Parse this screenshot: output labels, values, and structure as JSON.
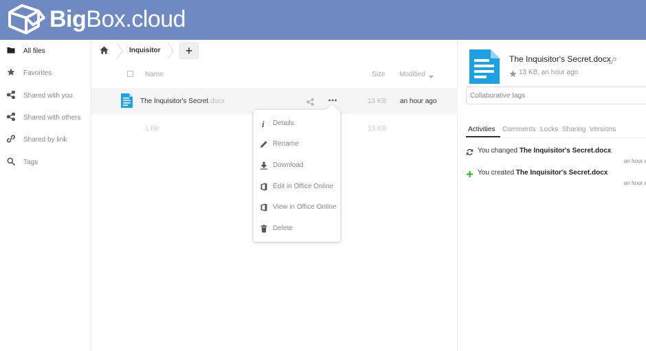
{
  "brand": {
    "name_bold": "Big",
    "name_rest": "Box.cloud"
  },
  "sidebar": {
    "items": [
      {
        "label": "All files",
        "icon": "folder-icon",
        "active": true
      },
      {
        "label": "Favorites",
        "icon": "star-icon"
      },
      {
        "label": "Shared with you",
        "icon": "share-icon"
      },
      {
        "label": "Shared with others",
        "icon": "share-icon"
      },
      {
        "label": "Shared by link",
        "icon": "link-icon"
      },
      {
        "label": "Tags",
        "icon": "search-icon"
      }
    ]
  },
  "breadcrumb": {
    "folder": "Inquisitor",
    "new_label": "+"
  },
  "table": {
    "headers": {
      "name": "Name",
      "size": "Size",
      "modified": "Modified"
    },
    "files": [
      {
        "name": "The Inquisitor's Secret",
        "ext": ".docx",
        "size": "13 KB",
        "modified": "an hour ago"
      }
    ],
    "summary": {
      "count": "1 file",
      "total_size": "13 KB"
    }
  },
  "context_menu": {
    "items": [
      {
        "label": "Details",
        "icon": "info-icon"
      },
      {
        "label": "Rename",
        "icon": "pencil-icon"
      },
      {
        "label": "Download",
        "icon": "download-icon"
      },
      {
        "label": "Edit in Office Online",
        "icon": "office-icon"
      },
      {
        "label": "View in Office Online",
        "icon": "office-icon"
      },
      {
        "label": "Delete",
        "icon": "trash-icon"
      }
    ]
  },
  "details": {
    "title": "The Inquisitor's Secret.docx",
    "meta": "13 KB, an hour ago",
    "tags_placeholder": "Collaborative tags",
    "tabs": [
      "Activities",
      "Comments",
      "Locks",
      "Sharing",
      "Versions"
    ],
    "activities": [
      {
        "prefix": "You changed ",
        "file": "The Inquisitor's Secret.docx",
        "time": "an hour ago",
        "icon": "sync-icon"
      },
      {
        "prefix": "You created ",
        "file": "The Inquisitor's Secret.docx",
        "time": "an hour ago",
        "icon": "plus-icon"
      }
    ]
  },
  "colors": {
    "header": "#6f8ac3",
    "doc_icon": "#1da1e4",
    "created_green": "#2ab82a"
  }
}
